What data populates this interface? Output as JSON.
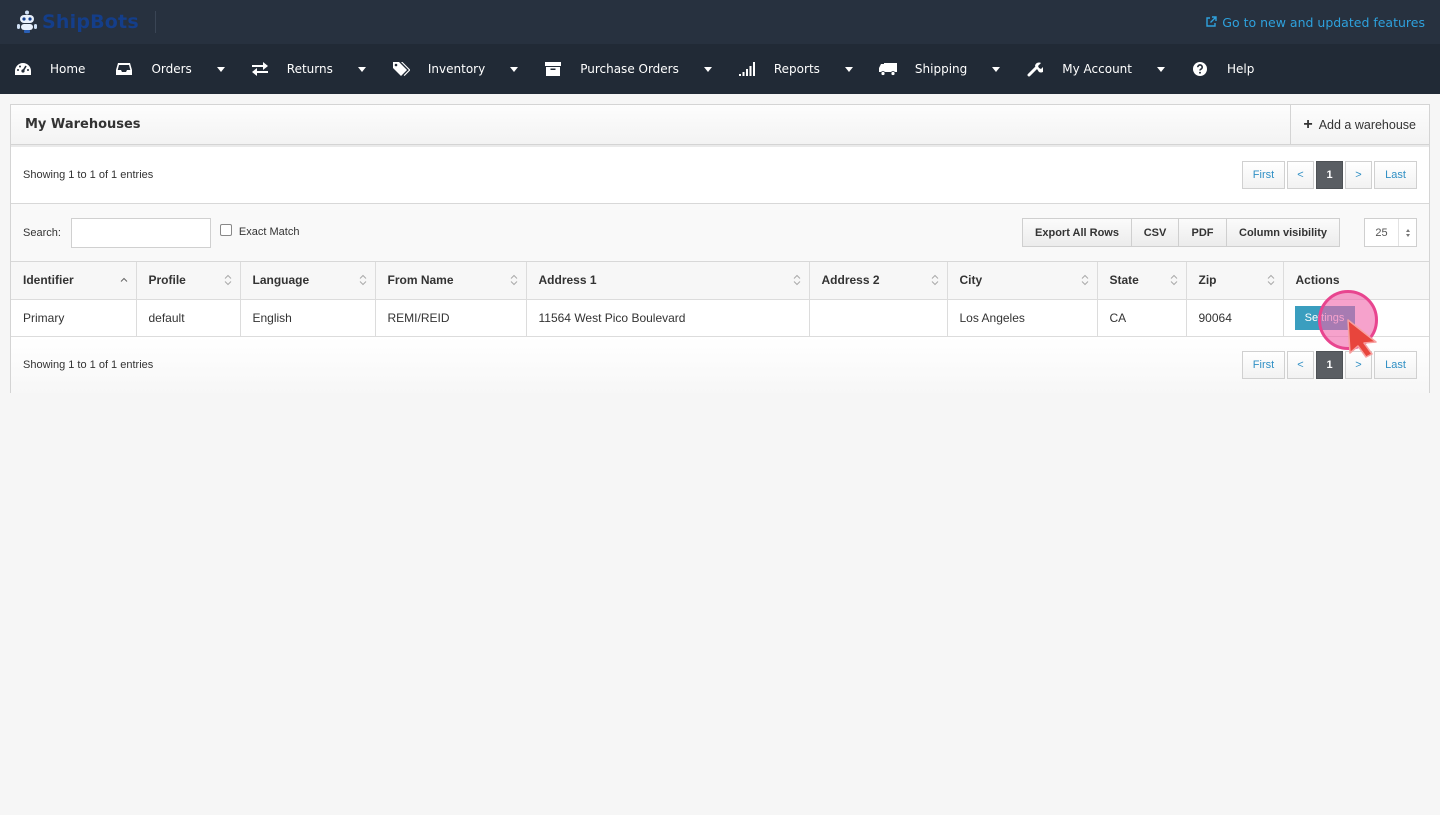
{
  "topbar": {
    "brand": "ShipBots",
    "new_features_link": "Go to new and updated features",
    "colors": {
      "brand": "#143e8a",
      "link": "#2ea1dd",
      "topbar_bg": "#27313f",
      "navbar_bg": "#212a36"
    }
  },
  "nav": {
    "items": [
      {
        "label": "Home",
        "icon": "dashboard-icon",
        "has_dropdown": false
      },
      {
        "label": "Orders",
        "icon": "inbox-icon",
        "has_dropdown": true
      },
      {
        "label": "Returns",
        "icon": "exchange-icon",
        "has_dropdown": true
      },
      {
        "label": "Inventory",
        "icon": "tags-icon",
        "has_dropdown": true
      },
      {
        "label": "Purchase Orders",
        "icon": "archive-icon",
        "has_dropdown": true
      },
      {
        "label": "Reports",
        "icon": "signal-icon",
        "has_dropdown": true
      },
      {
        "label": "Shipping",
        "icon": "truck-icon",
        "has_dropdown": true
      },
      {
        "label": "My Account",
        "icon": "wrench-icon",
        "has_dropdown": true
      },
      {
        "label": "Help",
        "icon": "question-circle-icon",
        "has_dropdown": false
      }
    ]
  },
  "panel": {
    "title": "My Warehouses",
    "add_button": "Add a warehouse",
    "info_top": "Showing 1 to 1 of 1 entries",
    "info_bottom": "Showing 1 to 1 of 1 entries",
    "pager": {
      "first": "First",
      "prev": "<",
      "current": "1",
      "next": ">",
      "last": "Last"
    },
    "search": {
      "label": "Search:",
      "value": "",
      "placeholder": "",
      "exact_match_label": "Exact Match",
      "exact_match_checked": false
    },
    "tools": [
      "Export All Rows",
      "CSV",
      "PDF",
      "Column visibility"
    ],
    "page_length": "25"
  },
  "table": {
    "columns": [
      {
        "label": "Identifier",
        "sort": "asc"
      },
      {
        "label": "Profile",
        "sort": "both"
      },
      {
        "label": "Language",
        "sort": "both"
      },
      {
        "label": "From Name",
        "sort": "both"
      },
      {
        "label": "Address 1",
        "sort": "both"
      },
      {
        "label": "Address 2",
        "sort": "both"
      },
      {
        "label": "City",
        "sort": "both"
      },
      {
        "label": "State",
        "sort": "both"
      },
      {
        "label": "Zip",
        "sort": "both"
      },
      {
        "label": "Actions",
        "sort": "none"
      }
    ],
    "rows": [
      {
        "identifier": "Primary",
        "profile": "default",
        "language": "English",
        "from_name": "REMI/REID",
        "address1": "11564 West Pico Boulevard",
        "address2": "",
        "city": "Los Angeles",
        "state": "CA",
        "zip": "90064",
        "action_label": "Settings"
      }
    ]
  }
}
